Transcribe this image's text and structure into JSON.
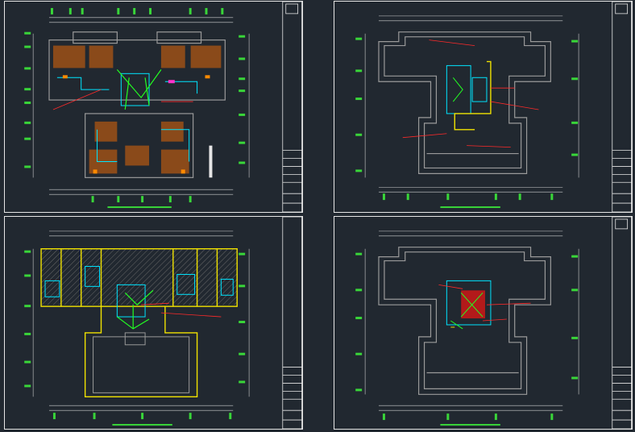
{
  "drawing_set": {
    "background": "#212830",
    "sheets": [
      {
        "id": "s1",
        "kind": "typical-floor-electrical"
      },
      {
        "id": "s2",
        "kind": "roof-electrical"
      },
      {
        "id": "s3",
        "kind": "first-floor-electrical"
      },
      {
        "id": "s4",
        "kind": "roof-machine-room-electrical"
      }
    ]
  },
  "colors": {
    "frame": "#e6e6e6",
    "wall": "#9a9a9a",
    "dimension": "#cfcfcf",
    "axis_bubble": "#39d639",
    "wiring_cyan": "#00e5ff",
    "wiring_green": "#22ff22",
    "leader_red": "#ff2a2a",
    "fixture_orange": "#ff8a00",
    "stair_yellow": "#f2e300",
    "magenta": "#ff33cc"
  }
}
